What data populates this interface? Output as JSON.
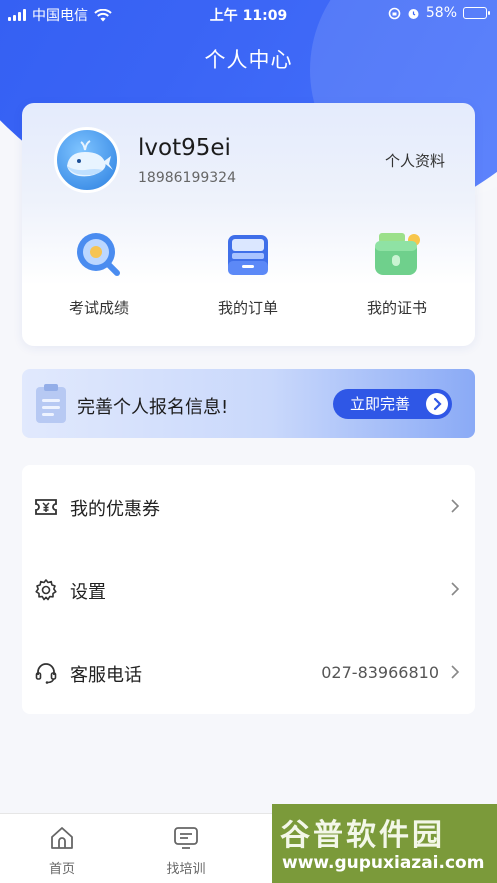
{
  "status_bar": {
    "carrier": "中国电信",
    "time": "上午 11:09",
    "battery": "58%",
    "battery_level": 0.58
  },
  "page_title": "个人中心",
  "profile": {
    "username": "lvot95ei",
    "phone": "18986199324",
    "profile_link": "个人资料"
  },
  "quick_actions": [
    {
      "label": "考试成绩",
      "icon": "search-result-icon"
    },
    {
      "label": "我的订单",
      "icon": "order-box-icon"
    },
    {
      "label": "我的证书",
      "icon": "certificate-wallet-icon"
    }
  ],
  "banner": {
    "text": "完善个人报名信息!",
    "button": "立即完善"
  },
  "menu": [
    {
      "label": "我的优惠券",
      "value": "",
      "icon": "coupon-icon"
    },
    {
      "label": "设置",
      "value": "",
      "icon": "gear-icon"
    },
    {
      "label": "客服电话",
      "value": "027-83966810",
      "icon": "headset-icon"
    }
  ],
  "tabs": [
    {
      "label": "首页",
      "icon": "home-icon"
    },
    {
      "label": "找培训",
      "icon": "training-icon"
    }
  ],
  "watermark": {
    "title": "谷普软件园",
    "url": "www.gupuxiazai.com"
  },
  "colors": {
    "primary": "#2f57e6",
    "header": "#3a64f5"
  }
}
